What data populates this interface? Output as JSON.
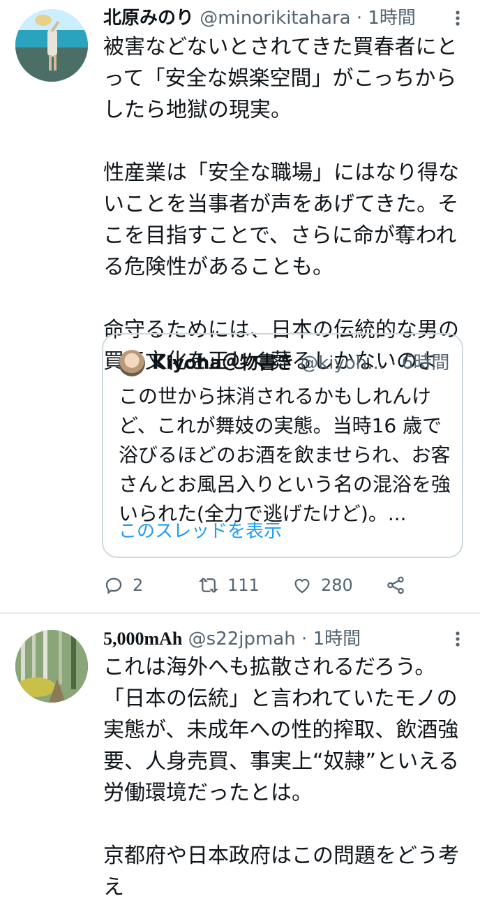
{
  "tweets": [
    {
      "name": "北原みのり",
      "handle": "@minorikitahara",
      "separator": "·",
      "time": "1時間",
      "more_icon": "⋮",
      "text": "被害などないとされてきた買春者にとって「安全な娯楽空間」がこっちからしたら地獄の現実。\n\n性産業は「安全な職場」にはなり得ないことを当事者が声をあげてきた。そこを目指すことで、さらに命が奪われる危険性があることも。\n\n命守るためには、日本の伝統的な男の買春文化を正しく葬るしかないのよ",
      "quote": {
        "name": "Kiyoha＠物書き",
        "handle": "@kiyoh...",
        "separator": "·",
        "time": "6時間",
        "text": "この世から抹消されるかもしれんけど、これが舞妓の実態。当時16 歳で浴びるほどのお酒を飲ませられ、お客さんとお風呂入りという名の混浴を強いられた(全力で逃げたけど)。...",
        "link": "このスレッドを表示"
      },
      "actions": {
        "replies": "2",
        "retweets": "111",
        "likes": "280"
      }
    },
    {
      "name": "5,000mAh",
      "handle": "@s22jpmah",
      "separator": "·",
      "time": "1時間",
      "more_icon": "⋮",
      "text": "これは海外へも拡散されるだろう。\n「日本の伝統」と言われていたモノの実態が、未成年への性的搾取、飲酒強要、人身売買、事実上“奴隷”といえる労働環境だったとは。\n\n京都府や日本政府はこの問題をどう考え"
    }
  ],
  "icons": {
    "reply": "reply-icon",
    "retweet": "retweet-icon",
    "like": "heart-icon",
    "share": "share-icon"
  },
  "colors": {
    "link": "#1d9bf0",
    "muted": "#536471",
    "border": "#cfd9de"
  }
}
